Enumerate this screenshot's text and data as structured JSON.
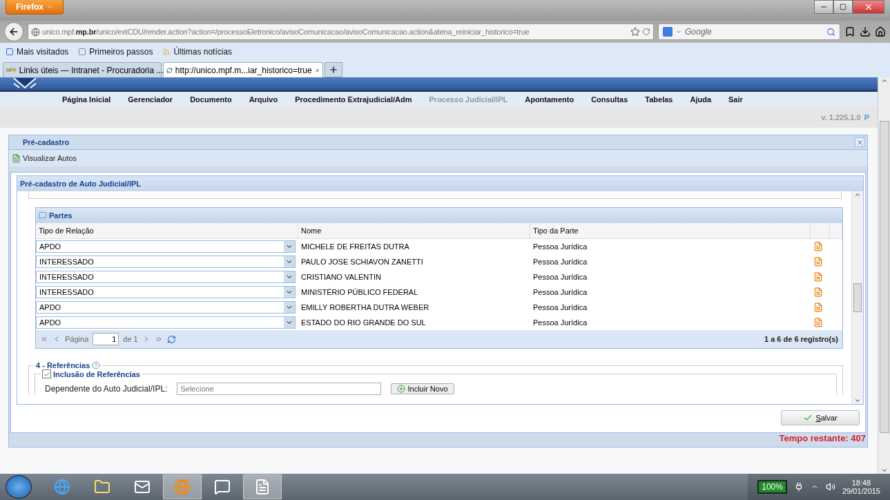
{
  "browser": {
    "menu_button": "Firefox",
    "url": "unico.mpf.**mp.br**/unico/extCDU/render.action?action=/processoEletronico/avisoComunicacao/avisoComunicacao.action&atena_reiniciar_historico=true",
    "search_placeholder": "Google"
  },
  "bookmarks": [
    "Mais visitados",
    "Primeiros passos",
    "Últimas notícias"
  ],
  "tabs": [
    {
      "favicon": "MPF",
      "label": "Links úteis — Intranet - Procuradoria ...",
      "selected": false
    },
    {
      "label": "http://unico.mpf.m...iar_historico=true",
      "selected": true
    }
  ],
  "site_menu": [
    {
      "label": "Página Inicial",
      "disabled": false
    },
    {
      "label": "Gerenciador",
      "disabled": false
    },
    {
      "label": "Documento",
      "disabled": false
    },
    {
      "label": "Arquivo",
      "disabled": false
    },
    {
      "label": "Procedimento Extrajudicial/Adm",
      "disabled": false
    },
    {
      "label": "Processo Judicial/IPL",
      "disabled": true
    },
    {
      "label": "Apontamento",
      "disabled": false
    },
    {
      "label": "Consultas",
      "disabled": false
    },
    {
      "label": "Tabelas",
      "disabled": false
    },
    {
      "label": "Ajuda",
      "disabled": false
    },
    {
      "label": "Sair",
      "disabled": false
    }
  ],
  "version": {
    "text": "v. 1.225.1.0",
    "mark": "P"
  },
  "panel": {
    "title": "Pré-cadastro",
    "toolbar_button": "Visualizar Autos",
    "form_title": "Pré-cadastro de Auto Judicial/IPL",
    "grid": {
      "title": "Partes",
      "columns": [
        "Tipo de Relação",
        "Nome",
        "Tipo da Parte"
      ],
      "rows": [
        {
          "relation": "APDO",
          "name": "MICHELE DE FREITAS DUTRA",
          "type": "Pessoa Jurídica"
        },
        {
          "relation": "INTERESSADO",
          "name": "PAULO JOSE SCHIAVON ZANETTI",
          "type": "Pessoa Jurídica"
        },
        {
          "relation": "INTERESSADO",
          "name": "CRISTIANO VALENTIN",
          "type": "Pessoa Jurídica"
        },
        {
          "relation": "INTERESSADO",
          "name": "MINISTÉRIO PÚBLICO FEDERAL",
          "type": "Pessoa Jurídica"
        },
        {
          "relation": "APDO",
          "name": "EMILLY ROBERTHA DUTRA WEBER",
          "type": "Pessoa Jurídica"
        },
        {
          "relation": "APDO",
          "name": "ESTADO DO RIO GRANDE DO SUL",
          "type": "Pessoa Jurídica"
        }
      ],
      "pager": {
        "page_label": "Página",
        "page": "1",
        "of": "de 1",
        "summary": "1 a 6 de 6 registro(s)"
      }
    },
    "section": {
      "title": "4 - Referências",
      "subsection": "Inclusão de Referências",
      "checked": true,
      "field_label": "Dependente do Auto Judicial/IPL:",
      "placeholder": "Selecione",
      "add_button": "Incluir Novo"
    },
    "save_button": "Salvar",
    "timer": "Tempo restante: 407"
  },
  "taskbar": {
    "battery": "100%",
    "time": "18:48",
    "date": "29/01/2015"
  }
}
